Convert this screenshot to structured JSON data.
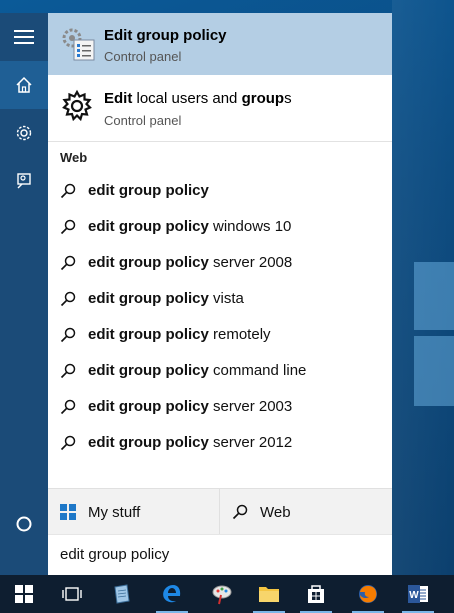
{
  "start_menu": {
    "rail": {
      "menu_icon": "hamburger-icon",
      "home_icon": "home-icon",
      "settings_icon": "gear-icon",
      "feedback_icon": "feedback-icon",
      "cortana_icon": "cortana-circle-icon"
    },
    "best_match": {
      "title": "Edit group policy",
      "subtitle": "Control panel",
      "icon": "group-policy-icon"
    },
    "local_result": {
      "title_bold_1": "Edit",
      "title_normal_1": " local users and ",
      "title_bold_2": "group",
      "title_normal_2": "s",
      "subtitle": "Control panel",
      "icon": "gear-icon"
    },
    "web_header": "Web",
    "suggestions": [
      {
        "bold": "edit group policy",
        "rest": ""
      },
      {
        "bold": "edit group policy",
        "rest": " windows 10"
      },
      {
        "bold": "edit group policy",
        "rest": " server 2008"
      },
      {
        "bold": "edit group policy",
        "rest": " vista"
      },
      {
        "bold": "edit group policy",
        "rest": " remotely"
      },
      {
        "bold": "edit group policy",
        "rest": " command line"
      },
      {
        "bold": "edit group policy",
        "rest": " server 2003"
      },
      {
        "bold": "edit group policy",
        "rest": " server 2012"
      }
    ],
    "scopes": {
      "my_stuff": "My stuff",
      "web": "Web"
    },
    "search_query": "edit group policy"
  },
  "taskbar": {
    "items": [
      "windows-start-icon",
      "task-view-icon",
      "notepad-app-icon",
      "edge-browser-icon",
      "paint-app-icon",
      "file-explorer-icon",
      "store-icon",
      "firefox-icon",
      "word-icon"
    ]
  },
  "colors": {
    "accent": "#1b4b78",
    "highlight": "#b4cee4",
    "taskbar": "#0e1e30"
  }
}
